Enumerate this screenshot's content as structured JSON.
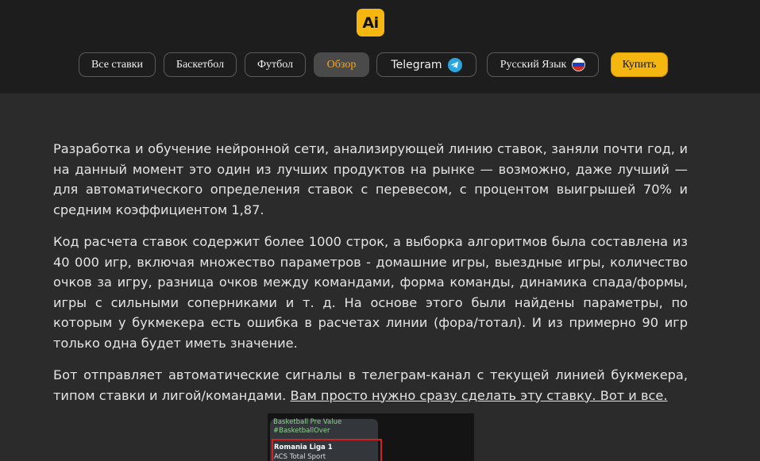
{
  "header": {
    "logo_text": "Ai",
    "nav": [
      {
        "label": "Все ставки"
      },
      {
        "label": "Баскетбол"
      },
      {
        "label": "Футбол"
      },
      {
        "label": "Обзор",
        "active": true
      },
      {
        "label": "Telegram",
        "icon": "telegram-icon"
      },
      {
        "label": "Русский Язык",
        "icon": "russia-flag-icon"
      },
      {
        "label": "Купить"
      }
    ]
  },
  "main": {
    "paragraphs": [
      "Разработка и обучение нейронной сети, анализирующей линию ставок, заняли почти год, и на данный момент это один из лучших продуктов на рынке — возможно, даже лучший — для автоматического определения ставок с перевесом, с процентом выигрышей 70% и средним коэффициентом 1,87.",
      "Код расчета ставок содержит более 1000 строк, а выборка алгоритмов была составлена из 40 000 игр, включая множество параметров - домашние игры, выездные игры, количество очков за игру, разница очков между командами, форма команды, динамика спада/формы, игры с сильными соперниками и т. д. На основе этого были найдены параметры, по которым у букмекера есть ошибка в расчетах линии (фора/тотал). И из примерно 90 игр только одна будет иметь значение."
    ],
    "paragraph3_text": "Бот отправляет автоматические сигналы в телеграм-канал с текущей линией букмекера, типом ставки и лигой/командами. ",
    "paragraph3_link": "Вам просто нужно сразу сделать эту ставку. Вот и все."
  },
  "screenshot": {
    "line1": "Basketball Pre Value",
    "line2": "#BasketballOver",
    "line3": "Romania Liga 1",
    "line4": "ACS Total Sport"
  },
  "colors": {
    "accent": "#f5b70f",
    "active_text": "#f5a623",
    "background": "#2b2b2b",
    "header_bg": "#1d1d1d"
  }
}
